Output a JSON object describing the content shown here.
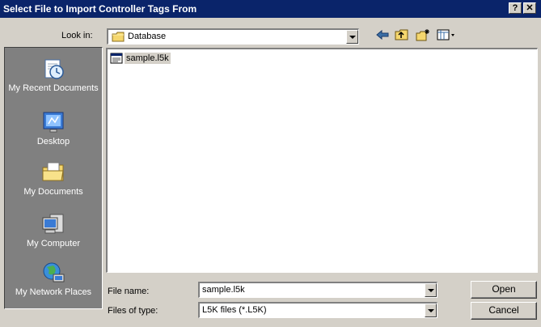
{
  "window": {
    "title": "Select File to Import Controller Tags From",
    "help_button": "?",
    "close_button": "✕"
  },
  "look_in": {
    "label": "Look in:",
    "value": "Database"
  },
  "toolbar": {
    "icons": [
      "back-arrow-icon",
      "up-folder-icon",
      "new-folder-icon",
      "view-menu-icon"
    ]
  },
  "places_bar": {
    "items": [
      {
        "label": "My Recent Documents",
        "icon": "recent-documents-icon"
      },
      {
        "label": "Desktop",
        "icon": "desktop-icon"
      },
      {
        "label": "My Documents",
        "icon": "my-documents-icon"
      },
      {
        "label": "My Computer",
        "icon": "my-computer-icon"
      },
      {
        "label": "My Network Places",
        "icon": "network-places-icon"
      }
    ]
  },
  "file_list": {
    "items": [
      {
        "name": "sample.l5k",
        "icon": "l5k-file-icon",
        "selected": true
      }
    ]
  },
  "file_name": {
    "label": "File name:",
    "value": "sample.l5k"
  },
  "file_type": {
    "label": "Files of type:",
    "value": "L5K files (*.L5K)"
  },
  "buttons": {
    "open": "Open",
    "cancel": "Cancel"
  },
  "colors": {
    "title_bar": "#0a246a",
    "dialog_face": "#d4d0c8",
    "places_bar": "#808080"
  }
}
